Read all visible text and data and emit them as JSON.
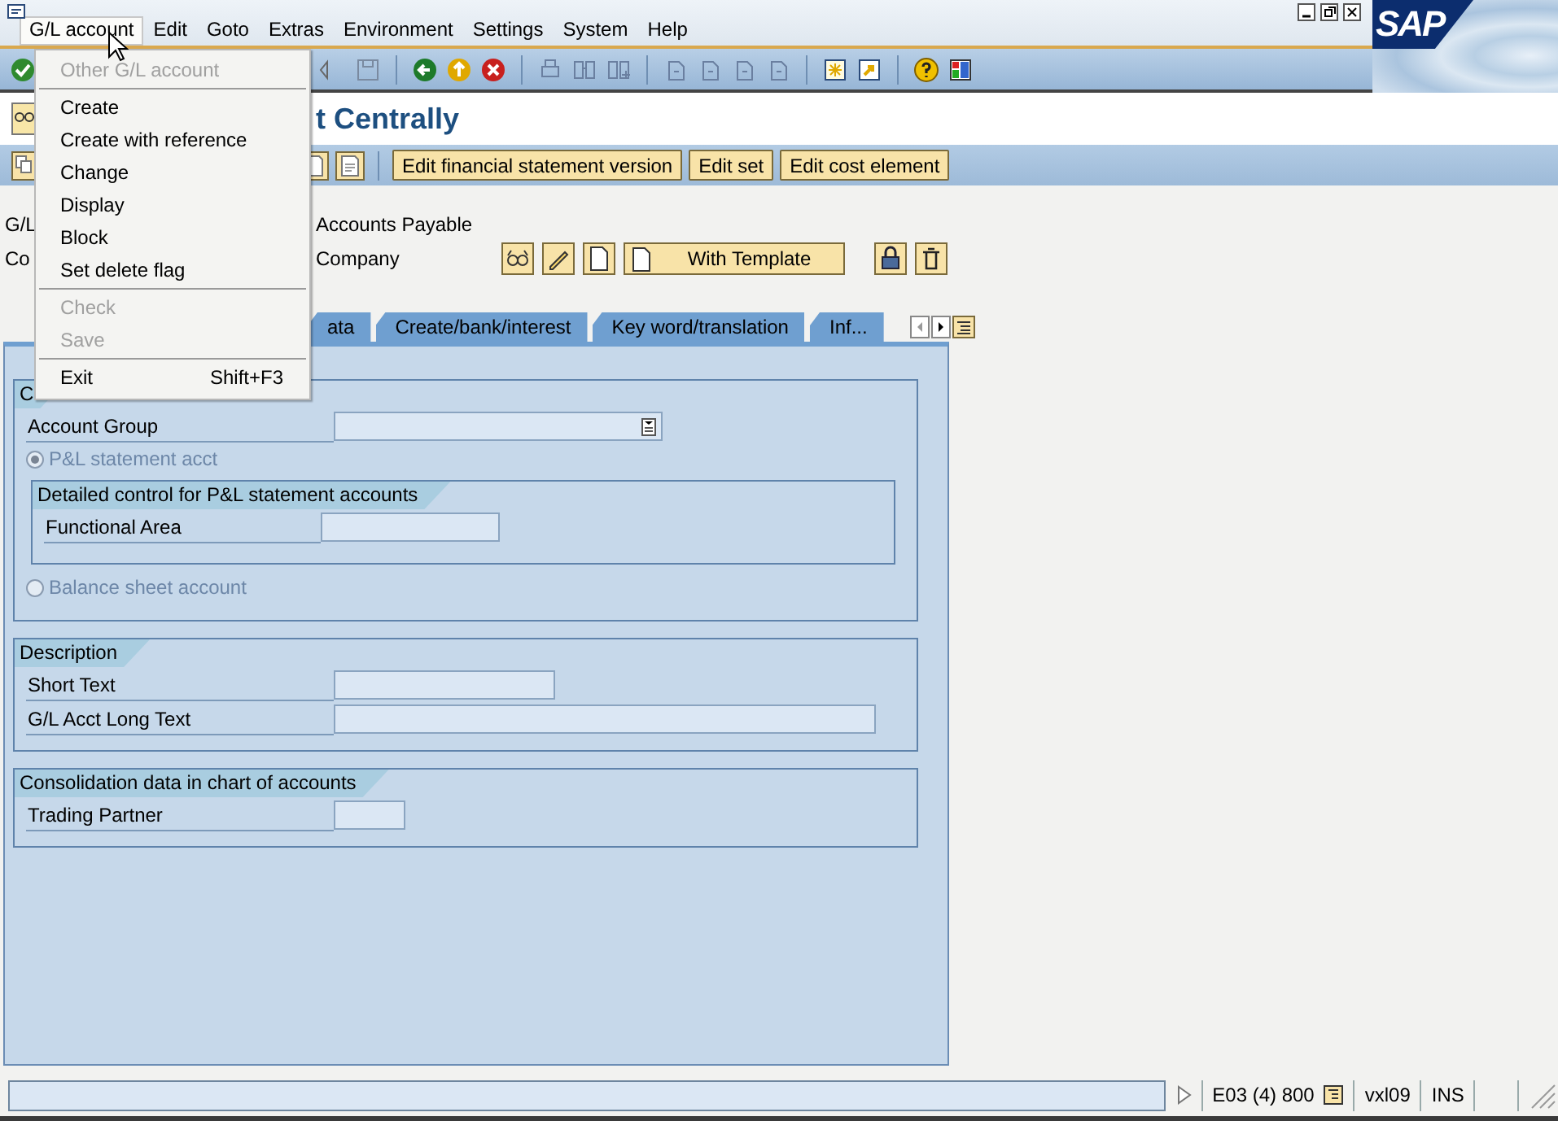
{
  "window": {
    "logo": "SAP"
  },
  "menubar": [
    {
      "label": "G/L account",
      "selected": true
    },
    {
      "label": "Edit",
      "selected": false
    },
    {
      "label": "Goto",
      "selected": false
    },
    {
      "label": "Extras",
      "selected": false
    },
    {
      "label": "Environment",
      "selected": false
    },
    {
      "label": "Settings",
      "selected": false
    },
    {
      "label": "System",
      "selected": false
    },
    {
      "label": "Help",
      "selected": false
    }
  ],
  "menu": {
    "items": [
      {
        "kind": "item",
        "label": "Other G/L account",
        "disabled": true
      },
      {
        "kind": "separator"
      },
      {
        "kind": "item",
        "label": "Create",
        "disabled": false
      },
      {
        "kind": "item",
        "label": "Create with reference",
        "disabled": false
      },
      {
        "kind": "item",
        "label": "Change",
        "disabled": false
      },
      {
        "kind": "item",
        "label": "Display",
        "disabled": false
      },
      {
        "kind": "item",
        "label": "Block",
        "disabled": false
      },
      {
        "kind": "item",
        "label": "Set delete flag",
        "disabled": false
      },
      {
        "kind": "separator"
      },
      {
        "kind": "item",
        "label": "Check",
        "disabled": true
      },
      {
        "kind": "item",
        "label": "Save",
        "disabled": true
      },
      {
        "kind": "separator"
      },
      {
        "kind": "item",
        "label": "Exit",
        "shortcut": "Shift+F3",
        "disabled": false
      }
    ]
  },
  "title": "t Centrally",
  "app_toolbar": {
    "buttons": [
      "Edit financial statement version",
      "Edit set",
      "Edit cost element"
    ]
  },
  "header": {
    "rows": [
      {
        "label": "G/L",
        "value": "Accounts Payable"
      },
      {
        "label": "Co",
        "value": "Company"
      }
    ],
    "template_button": "With Template"
  },
  "tabs": [
    {
      "label": "ata",
      "selected": false
    },
    {
      "label": "Create/bank/interest",
      "selected": false
    },
    {
      "label": "Key word/translation",
      "selected": false
    },
    {
      "label": "Inf...",
      "selected": false
    }
  ],
  "groups": [
    {
      "title": "C",
      "items": [
        {
          "kind": "field",
          "label": "Account Group",
          "dropdown": true
        },
        {
          "kind": "radio",
          "label": "P&L statement acct",
          "selected": true,
          "disabled": true
        },
        {
          "kind": "subgroup",
          "title": "Detailed control for P&L statement accounts",
          "items": [
            {
              "kind": "field",
              "label": "Functional Area"
            }
          ]
        },
        {
          "kind": "radio",
          "label": "Balance sheet account",
          "selected": false,
          "disabled": true
        }
      ]
    },
    {
      "title": "Description",
      "items": [
        {
          "kind": "field",
          "label": "Short Text"
        },
        {
          "kind": "field",
          "label": "G/L Acct Long Text"
        }
      ]
    },
    {
      "title": "Consolidation data in chart of accounts",
      "items": [
        {
          "kind": "field",
          "label": "Trading Partner"
        }
      ]
    }
  ],
  "status_bar": {
    "system": "E03 (4) 800",
    "server": "vxl09",
    "mode": "INS"
  }
}
